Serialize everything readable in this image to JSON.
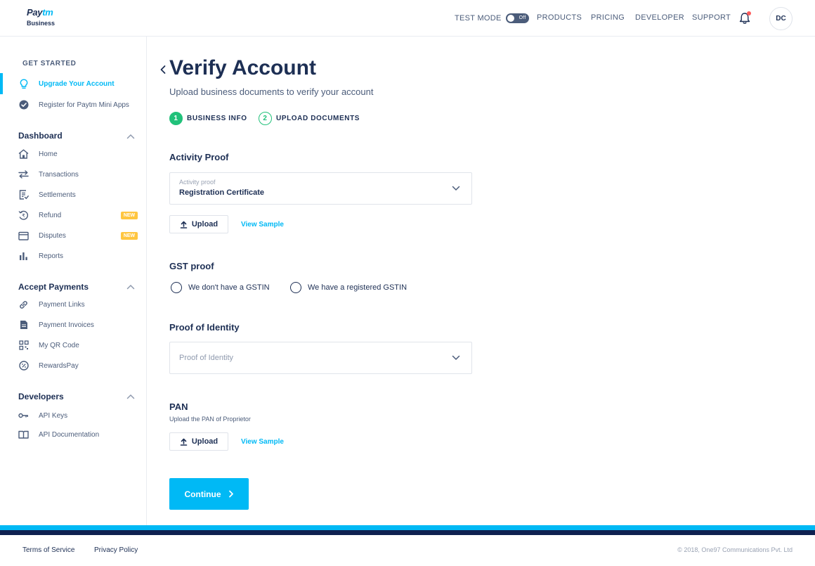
{
  "header": {
    "logo_brand": "Paytm",
    "logo_sub": "Business",
    "test_mode_label": "TEST MODE",
    "test_mode_state": "Off",
    "nav": [
      "PRODUCTS",
      "PRICING",
      "DEVELOPER",
      "SUPPORT"
    ],
    "avatar_initials": "DC"
  },
  "sidebar": {
    "get_started": "GET STARTED",
    "get_started_items": [
      {
        "label": "Upgrade Your Account",
        "icon": "bulb-icon",
        "active": true
      },
      {
        "label": "Register for Paytm Mini Apps",
        "icon": "check-circle-icon",
        "active": false
      }
    ],
    "sections": [
      {
        "title": "Dashboard",
        "items": [
          {
            "label": "Home",
            "icon": "home-icon"
          },
          {
            "label": "Transactions",
            "icon": "transfer-arrows-icon"
          },
          {
            "label": "Settlements",
            "icon": "settlements-icon"
          },
          {
            "label": "Refund",
            "icon": "refund-icon",
            "badge": "NEW"
          },
          {
            "label": "Disputes",
            "icon": "disputes-icon",
            "badge": "NEW"
          },
          {
            "label": "Reports",
            "icon": "bar-chart-icon"
          }
        ]
      },
      {
        "title": "Accept Payments",
        "items": [
          {
            "label": "Payment Links",
            "icon": "link-icon"
          },
          {
            "label": "Payment Invoices",
            "icon": "invoice-icon"
          },
          {
            "label": "My QR Code",
            "icon": "qr-code-icon"
          },
          {
            "label": "RewardsPay",
            "icon": "percent-icon"
          }
        ]
      },
      {
        "title": "Developers",
        "items": [
          {
            "label": "API Keys",
            "icon": "key-icon"
          },
          {
            "label": "API Documentation",
            "icon": "book-icon"
          }
        ]
      }
    ]
  },
  "main": {
    "title": "Verify Account",
    "subtitle": "Upload business documents to verify your account",
    "steps": [
      {
        "num": "1",
        "label": "BUSINESS INFO",
        "state": "done"
      },
      {
        "num": "2",
        "label": "UPLOAD DOCUMENTS",
        "state": "current"
      }
    ],
    "activity": {
      "title": "Activity Proof",
      "select_label": "Activity proof",
      "select_value": "Registration Certificate",
      "upload_label": "Upload",
      "sample_label": "View Sample"
    },
    "gst": {
      "title": "GST proof",
      "options": [
        "We don't have a GSTIN",
        "We have a registered GSTIN"
      ]
    },
    "identity": {
      "title": "Proof of Identity",
      "placeholder": "Proof of Identity"
    },
    "pan": {
      "title": "PAN",
      "subtitle": "Upload the PAN of Proprietor",
      "upload_label": "Upload",
      "sample_label": "View Sample"
    },
    "continue_label": "Continue"
  },
  "footer": {
    "links": [
      "Terms of Service",
      "Privacy Policy"
    ],
    "copyright": "© 2018, One97 Communications Pvt. Ltd"
  },
  "colors": {
    "accent": "#00b9f5",
    "navy": "#1d2f54",
    "success": "#21c17a",
    "badge": "#ffc640",
    "notification": "#fd5c5c",
    "footer_dark": "#0f2150"
  }
}
